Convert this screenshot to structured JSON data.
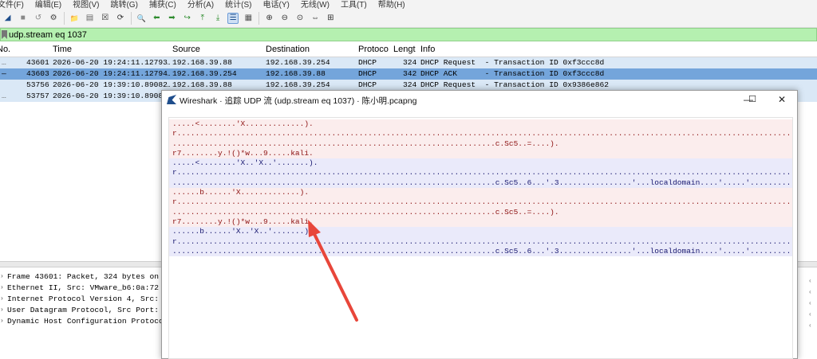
{
  "menu": [
    "文件(F)",
    "编辑(E)",
    "视图(V)",
    "跳转(G)",
    "捕获(C)",
    "分析(A)",
    "统计(S)",
    "电话(Y)",
    "无线(W)",
    "工具(T)",
    "帮助(H)"
  ],
  "toolbar": {
    "icons": [
      "shark-start-icon",
      "stop-icon",
      "restart-icon",
      "options-gear-icon",
      "open-folder-icon",
      "file-icon",
      "close-file-icon",
      "reload-icon",
      "find-icon",
      "back-icon",
      "forward-icon",
      "goto-packet-icon",
      "first-packet-icon",
      "last-packet-icon",
      "autoscroll-icon",
      "colorize-icon",
      "zoom-in-icon",
      "zoom-out-icon",
      "zoom-normal-icon",
      "resize-columns-icon",
      "layout-icon"
    ],
    "glyphs": [
      "◢",
      "■",
      "↺",
      "⚙",
      "📁",
      "▤",
      "☒",
      "⟳",
      "🔍",
      "⬅",
      "➡",
      "↪",
      "⤒",
      "⤓",
      "☰",
      "▦",
      "⊕",
      "⊖",
      "⊙",
      "⇔",
      "⊞"
    ]
  },
  "filter": {
    "value": "udp.stream eq 1037"
  },
  "columns": [
    "No.",
    "Time",
    "Source",
    "Destination",
    "Protoco",
    "Lengt",
    "Info"
  ],
  "packets": [
    {
      "no": "43601",
      "time": "2026-06-20 19:24:11.12793…",
      "src": "192.168.39.88",
      "dst": "192.168.39.254",
      "proto": "DHCP",
      "len": "324",
      "info": "DHCP Request  - Transaction ID 0xf3ccc8d"
    },
    {
      "no": "43603",
      "time": "2026-06-20 19:24:11.12794…",
      "src": "192.168.39.254",
      "dst": "192.168.39.88",
      "proto": "DHCP",
      "len": "342",
      "info": "DHCP ACK      - Transaction ID 0xf3ccc8d"
    },
    {
      "no": "53756",
      "time": "2026-06-20 19:39:10.89082…",
      "src": "192.168.39.88",
      "dst": "192.168.39.254",
      "proto": "DHCP",
      "len": "324",
      "info": "DHCP Request  - Transaction ID 0x9386e862"
    },
    {
      "no": "53757",
      "time": "2026-06-20 19:39:10.89083…",
      "src": "",
      "dst": "",
      "proto": "",
      "len": "",
      "info": ""
    }
  ],
  "details": [
    "Frame 43601: Packet, 324 bytes on w",
    "Ethernet II, Src: VMware_b6:0a:72 (",
    "Internet Protocol Version 4, Src: 1",
    "User Datagram Protocol, Src Port: 6",
    "Dynamic Host Configuration Protocol"
  ],
  "dialog": {
    "title": "Wireshark · 追踪 UDP 流 (udp.stream eq 1037) · 陈小明.pcapng",
    "minimize": "—",
    "maximize": "☐",
    "close": "✕",
    "lines": [
      {
        "side": "c",
        "text": ".....<........'X.............)."
      },
      {
        "side": "c",
        "text": "r..............................................................................................................................................."
      },
      {
        "side": "c",
        "text": ".......................................................................c.Sc5..=....)."
      },
      {
        "side": "c",
        "text": "r7........y.!()*w...9.....kali."
      },
      {
        "side": "s",
        "text": ".....<........'X..'X..'.......)."
      },
      {
        "side": "s",
        "text": "r..............................................................................................................................................."
      },
      {
        "side": "s",
        "text": ".......................................................................c.Sc5..6...'.3................'...localdomain....'.....'........."
      },
      {
        "side": "c",
        "text": "......b......'X.............)."
      },
      {
        "side": "c",
        "text": "r..............................................................................................................................................."
      },
      {
        "side": "c",
        "text": ".......................................................................c.Sc5..=....)."
      },
      {
        "side": "c",
        "text": "r7........y.!()*w...9.....kali."
      },
      {
        "side": "s",
        "text": "......b......'X..'X..'.......)."
      },
      {
        "side": "s",
        "text": "r..............................................................................................................................................."
      },
      {
        "side": "s",
        "text": ".......................................................................c.Sc5..6...'.3................'...localdomain....'.....'........."
      }
    ]
  },
  "colors": {
    "client_bg": "#fbeded",
    "client_fg": "#8c1010",
    "server_bg": "#eaeafa",
    "server_fg": "#17176f",
    "selected_row": "#74a5db",
    "filter_ok": "#b5f0b0",
    "arrow": "#e8463a"
  }
}
